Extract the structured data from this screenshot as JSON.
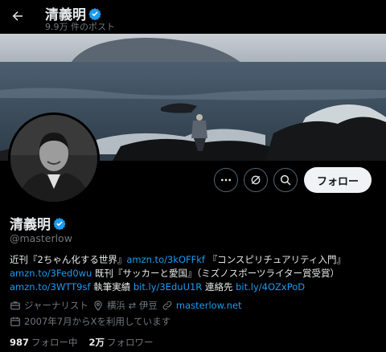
{
  "header": {
    "name": "清義明",
    "post_count": "9.9万 件のポスト"
  },
  "profile": {
    "name": "清義明",
    "handle": "@masterlow",
    "follow_label": "フォロー"
  },
  "bio": {
    "line1_a": "近刊『2ちゃん化する世界』",
    "line1_link": "amzn.to/3kOFFkf",
    "line1_b": " 『コンスピリチュアリティ入門』",
    "line2_link": "amzn.to/3Fed0wu",
    "line2_b": " 既刊『サッカーと愛国』（ミズノスポーツライター賞受賞）",
    "line3_link1": "amzn.to/3WTT9sf",
    "line3_b": " 執筆実績 ",
    "line3_link2": "bit.ly/3EduU1R",
    "line3_c": " 連絡先 ",
    "line3_link3": "bit.ly/4OZxPoD"
  },
  "meta": {
    "category": "ジャーナリスト",
    "location": "横浜 ⇄ 伊豆",
    "website": "masterlow.net",
    "joined": "2007年7月からXを利用しています"
  },
  "stats": {
    "following_count": "987",
    "following_label": "フォロー中",
    "followers_count": "2万",
    "followers_label": "フォロワー"
  },
  "colors": {
    "accent": "#1d9bf0",
    "background": "#000000",
    "muted": "#71767b"
  },
  "icons": [
    "back-arrow-icon",
    "verified-badge-icon",
    "more-icon",
    "grok-icon",
    "search-icon",
    "briefcase-icon",
    "location-pin-icon",
    "link-icon",
    "calendar-icon"
  ]
}
